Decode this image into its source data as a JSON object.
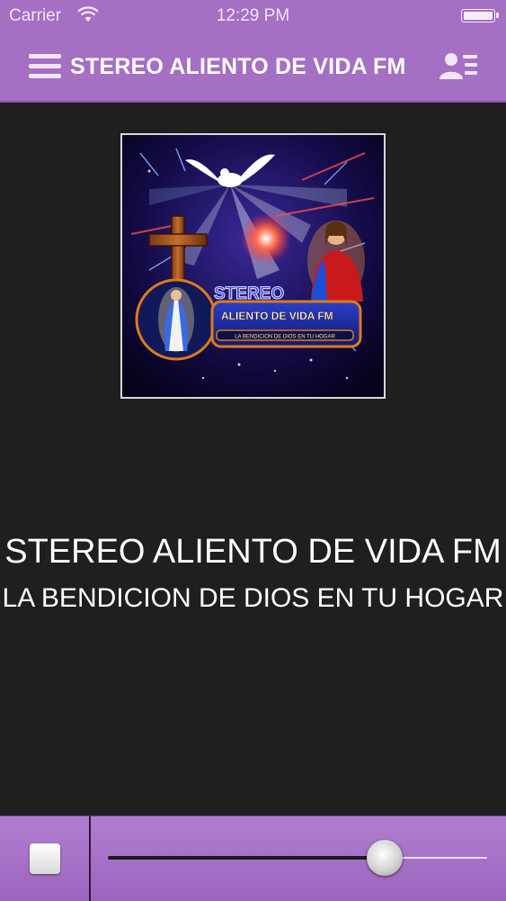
{
  "status_bar": {
    "carrier": "Carrier",
    "time": "12:29 PM",
    "wifi_icon": "wifi-icon",
    "battery_icon": "battery-icon"
  },
  "nav_bar": {
    "title": "STEREO ALIENTO DE VIDA FM",
    "menu_icon": "menu-icon",
    "contact_icon": "contact-list-icon",
    "background_color": "#a56fc4"
  },
  "artwork": {
    "logo_title": "STEREO",
    "logo_subtitle": "ALIENTO DE VIDA FM",
    "logo_tagline": "LA BENDICION DE DIOS EN TU HOGAR"
  },
  "station": {
    "name": "STEREO ALIENTO DE VIDA FM",
    "slogan": "LA BENDICION DE DIOS EN TU HOGAR"
  },
  "player": {
    "stop_icon": "stop-icon",
    "volume_level": 0.73,
    "background_color": "#a56fc4"
  }
}
